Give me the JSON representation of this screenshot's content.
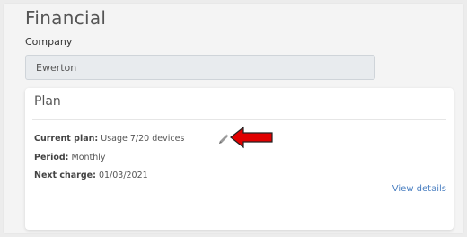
{
  "financial": {
    "title": "Financial",
    "company_label": "Company",
    "company_value": "Ewerton"
  },
  "plan": {
    "title": "Plan",
    "current_plan_label": "Current plan:",
    "current_plan_value": "Usage 7/20 devices",
    "period_label": "Period:",
    "period_value": "Monthly",
    "next_charge_label": "Next charge:",
    "next_charge_value": "01/03/2021",
    "view_details_label": "View details"
  },
  "icons": {
    "edit": "pencil-icon",
    "annotation": "red-arrow-left-icon"
  },
  "colors": {
    "link": "#4a7fc1",
    "annotation_arrow": "#e00000",
    "input_background": "#e8ebee"
  }
}
